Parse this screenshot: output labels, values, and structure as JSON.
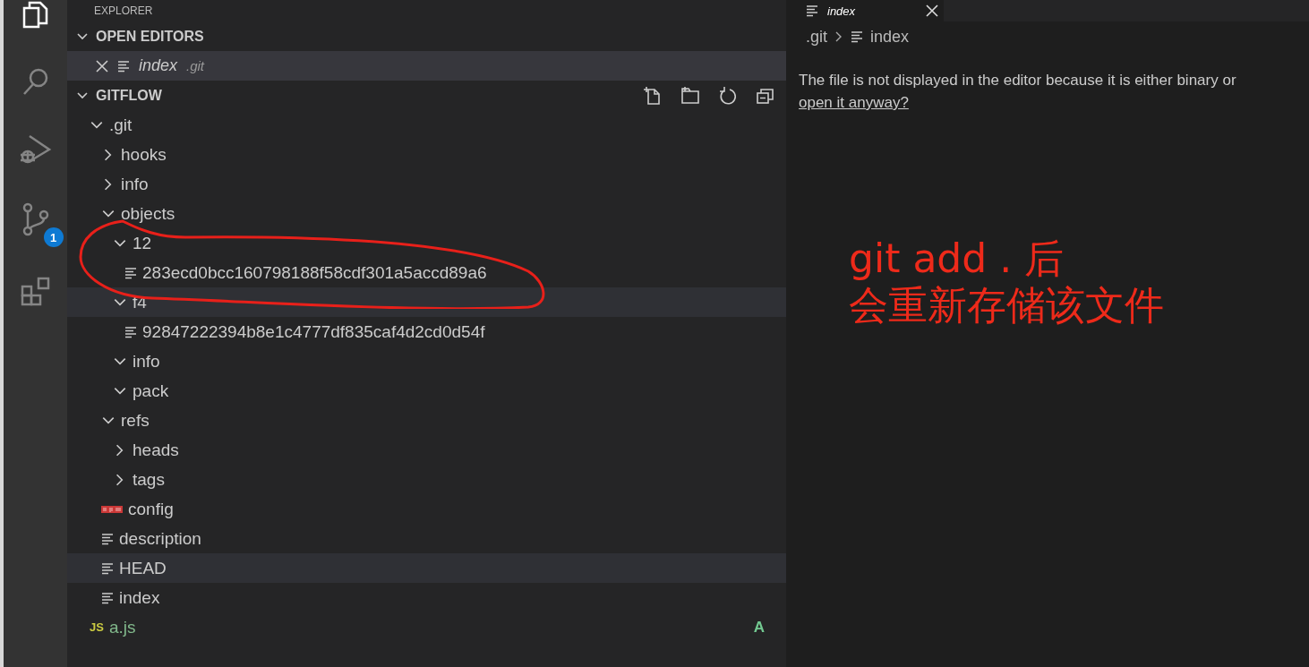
{
  "activity_bar": {
    "items": [
      {
        "kind": "files",
        "selected": true
      },
      {
        "kind": "search",
        "selected": false
      },
      {
        "kind": "debug",
        "selected": false
      },
      {
        "kind": "source-control",
        "selected": false,
        "badge": "1"
      },
      {
        "kind": "extensions",
        "selected": false
      }
    ]
  },
  "sidebar": {
    "title": "EXPLORER",
    "open_editors": {
      "title": "OPEN EDITORS",
      "expanded": true,
      "items": [
        {
          "name": "index",
          "folder": ".git",
          "selected": true
        }
      ]
    },
    "folder": {
      "title": "GITFLOW",
      "expanded": true,
      "tree": [
        {
          "name": ".git",
          "kind": "folder",
          "expanded": true,
          "highlighted": false,
          "children": [
            {
              "name": "hooks",
              "kind": "folder",
              "expanded": false,
              "highlighted": false
            },
            {
              "name": "info",
              "kind": "folder",
              "expanded": false,
              "highlighted": false
            },
            {
              "name": "objects",
              "kind": "folder",
              "expanded": true,
              "highlighted": false,
              "children": [
                {
                  "name": "12",
                  "kind": "folder",
                  "expanded": true,
                  "highlighted": false,
                  "children": [
                    {
                      "name": "283ecd0bcc160798188f58cdf301a5accd89a6",
                      "kind": "text",
                      "highlighted": false
                    }
                  ]
                },
                {
                  "name": "f4",
                  "kind": "folder",
                  "expanded": true,
                  "highlighted": true,
                  "children": [
                    {
                      "name": "92847222394b8e1c4777df835caf4d2cd0d54f",
                      "kind": "text",
                      "highlighted": false
                    }
                  ]
                },
                {
                  "name": "info",
                  "kind": "folder",
                  "expanded": true,
                  "highlighted": false
                },
                {
                  "name": "pack",
                  "kind": "folder",
                  "expanded": true,
                  "highlighted": false
                }
              ]
            },
            {
              "name": "refs",
              "kind": "folder",
              "expanded": true,
              "highlighted": false,
              "children": [
                {
                  "name": "heads",
                  "kind": "folder",
                  "expanded": false,
                  "highlighted": false
                },
                {
                  "name": "tags",
                  "kind": "folder",
                  "expanded": false,
                  "highlighted": false
                }
              ]
            },
            {
              "name": "config",
              "kind": "npm",
              "highlighted": false
            },
            {
              "name": "description",
              "kind": "text",
              "highlighted": false
            },
            {
              "name": "HEAD",
              "kind": "text",
              "highlighted": true
            },
            {
              "name": "index",
              "kind": "text",
              "highlighted": false
            }
          ]
        },
        {
          "name": "a.js",
          "kind": "script",
          "icon_label": "JS",
          "added": true,
          "badge": "A",
          "highlighted": false
        }
      ]
    }
  },
  "editor": {
    "tab": {
      "label": "index"
    },
    "breadcrumb": [
      ".git",
      "index"
    ],
    "message": "The file is not displayed in the editor because it is either binary or",
    "link": "open it anyway?"
  },
  "annotation": {
    "lines": [
      "git add . 后",
      "会重新存储该文件"
    ]
  }
}
